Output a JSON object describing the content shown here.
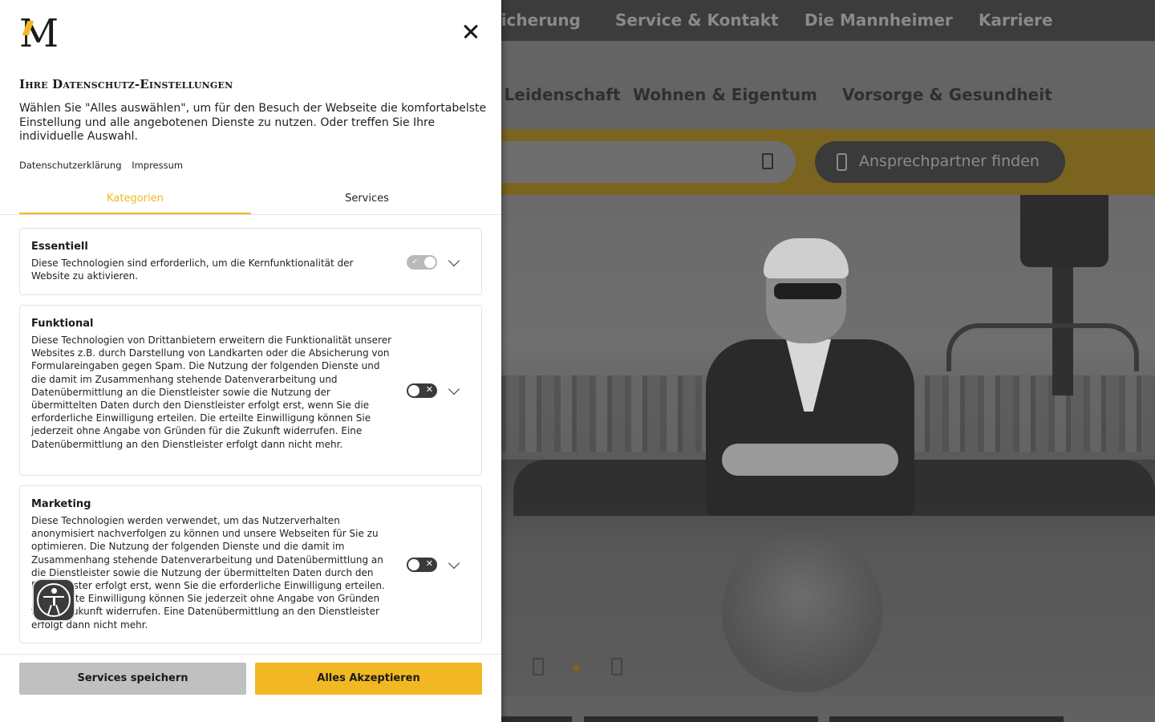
{
  "site": {
    "topnav": [
      "Absicherung",
      "Service & Kontakt",
      "Die Mannheimer",
      "Karriere"
    ],
    "mainnav": [
      "Hobby & Leidenschaft",
      "Wohnen & Eigentum",
      "Vorsorge & Gesundheit"
    ],
    "contact_button": "Ansprechpartner finden",
    "hero": {
      "slide_indicator": "1"
    }
  },
  "consent": {
    "logo": "M",
    "title": "Ihre Datenschutz-Einstellungen",
    "intro": "Wählen Sie \"Alles auswählen\", um für den Besuch der Webseite die komfortabelste Einstellung und alle angebotenen Dienste zu nutzen. Oder treffen Sie Ihre individuelle Auswahl.",
    "links": [
      "Datenschutzerklärung",
      "Impressum"
    ],
    "tabs": [
      "Kategorien",
      "Services"
    ],
    "active_tab": "Kategorien",
    "categories": [
      {
        "title": "Essentiell",
        "description": "Diese Technologien sind erforderlich, um die Kernfunktionalität der Website zu aktivieren.",
        "enabled": true
      },
      {
        "title": "Funktional",
        "description": "Diese Technologien von Drittanbietern erweitern die Funktionalität unserer Websites z.B. durch Darstellung von Landkarten oder die Absicherung von Formulareingaben gegen Spam. Die Nutzung der folgenden Dienste und die damit im Zusammenhang stehende Datenverarbeitung und Datenübermittlung an die Dienstleister sowie die Nutzung der übermittelten Daten durch den Dienstleister erfolgt erst, wenn Sie die erforderliche Einwilligung erteilen. Die erteilte Einwilligung können Sie jederzeit ohne Angabe von Gründen für die Zukunft widerrufen. Eine Datenübermittlung an den Dienstleister erfolgt dann nicht mehr.",
        "enabled": false
      },
      {
        "title": "Marketing",
        "description": "Diese Technologien werden verwendet, um das Nutzerverhalten anonymisiert nachverfolgen zu können und unsere Webseiten für Sie zu optimieren. Die Nutzung der folgenden Dienste und die damit im Zusammenhang stehende Datenverarbeitung und Datenübermittlung an die Dienstleister sowie die Nutzung der übermittelten Daten durch den Dienstleister erfolgt erst, wenn Sie die erforderliche Einwilligung erteilen. Die erteilte Einwilligung können Sie jederzeit ohne Angabe von Gründen für die Zukunft widerrufen. Eine Datenübermittlung an den Dienstleister erfolgt dann nicht mehr.",
        "enabled": false
      }
    ],
    "buttons": {
      "save": "Services speichern",
      "accept_all": "Alles Akzeptieren"
    },
    "colors": {
      "accent": "#f2b824",
      "toggle_off": "#3a3a3a",
      "toggle_on": "#b9b9b9"
    }
  }
}
